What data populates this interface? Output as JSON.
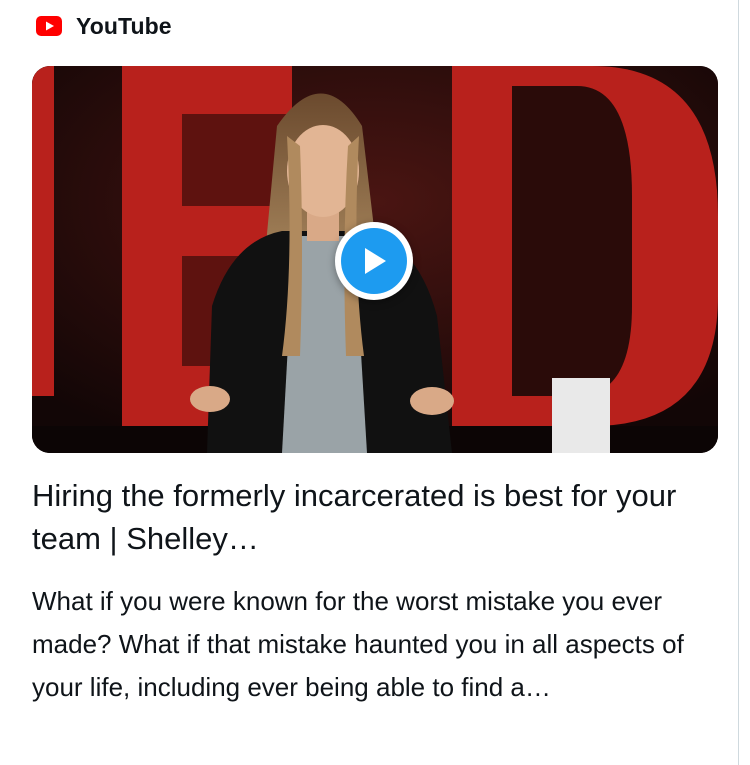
{
  "link_card": {
    "source": {
      "icon": "youtube-logo-icon",
      "name": "YouTube",
      "brand_color": "#ff0000"
    },
    "thumbnail": {
      "play_icon": "play-icon",
      "accent_color": "#1d9bf0"
    },
    "title": "Hiring the formerly incarcerated is best for your team | Shelley…",
    "description": "What if you were known for the worst mistake you ever made? What if that mistake haunted you in all aspects of your life, including ever being able to find a…"
  }
}
